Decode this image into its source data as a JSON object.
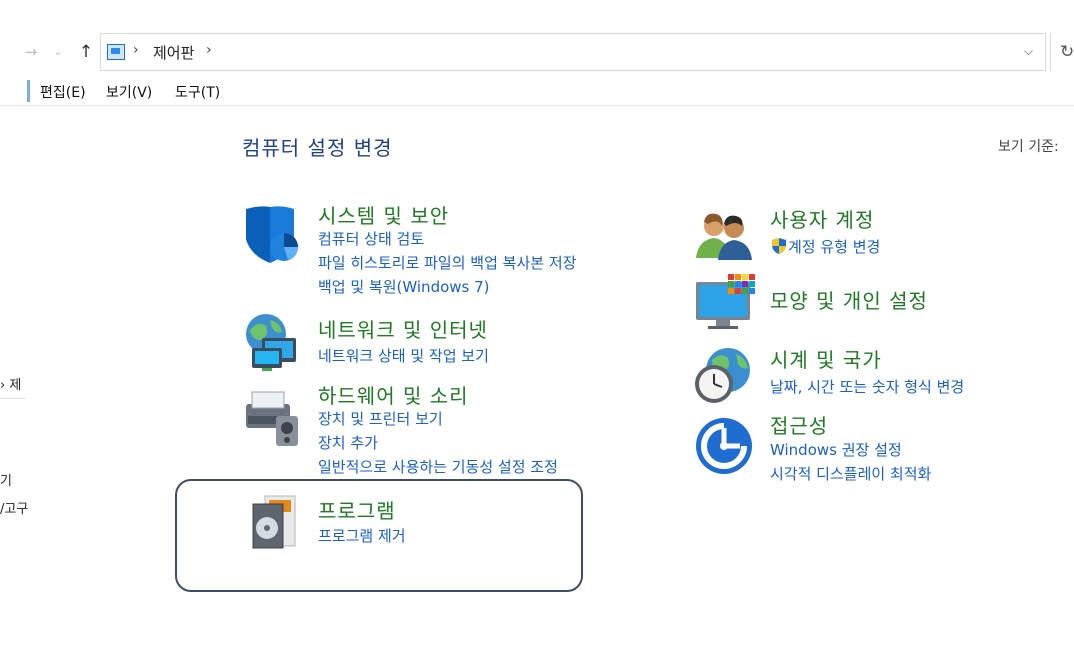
{
  "nav": {
    "back_icon": "→",
    "forward_icon": "⌄",
    "up_icon": "↑"
  },
  "address": {
    "breadcrumb": "제어판",
    "sep": "›",
    "dropdown_icon": "⌵",
    "refresh_icon": "↻"
  },
  "menu": {
    "edit": "편집(E)",
    "view": "보기(V)",
    "tools": "도구(T)"
  },
  "left_pane": {
    "item1": "› 제",
    "item2": "기",
    "item3": "/고구"
  },
  "header": {
    "title": "컴퓨터 설정 변경",
    "view_by": "보기 기준:"
  },
  "categories": {
    "system": {
      "title": "시스템 및 보안",
      "links": [
        "컴퓨터 상태 검토",
        "파일 히스토리로 파일의 백업 복사본 저장",
        "백업 및 복원(Windows 7)"
      ]
    },
    "network": {
      "title": "네트워크 및 인터넷",
      "links": [
        "네트워크 상태 및 작업 보기"
      ]
    },
    "hardware": {
      "title": "하드웨어 및 소리",
      "links": [
        "장치 및 프린터 보기",
        "장치 추가",
        "일반적으로 사용하는 기동성 설정 조정"
      ]
    },
    "programs": {
      "title": "프로그램",
      "links": [
        "프로그램 제거"
      ]
    },
    "users": {
      "title": "사용자 계정",
      "links": [
        "계정 유형 변경"
      ]
    },
    "appearance": {
      "title": "모양 및 개인 설정",
      "links": []
    },
    "clock": {
      "title": "시계 및 국가",
      "links": [
        "날짜, 시간 또는 숫자 형식 변경"
      ]
    },
    "access": {
      "title": "접근성",
      "links": [
        "Windows 권장 설정",
        "시각적 디스플레이 최적화"
      ]
    }
  },
  "colors": {
    "title_green": "#1e7a22",
    "link_blue": "#1a5fcf",
    "header_blue": "#1e3f8f",
    "highlight_border": "#3b4f68"
  }
}
